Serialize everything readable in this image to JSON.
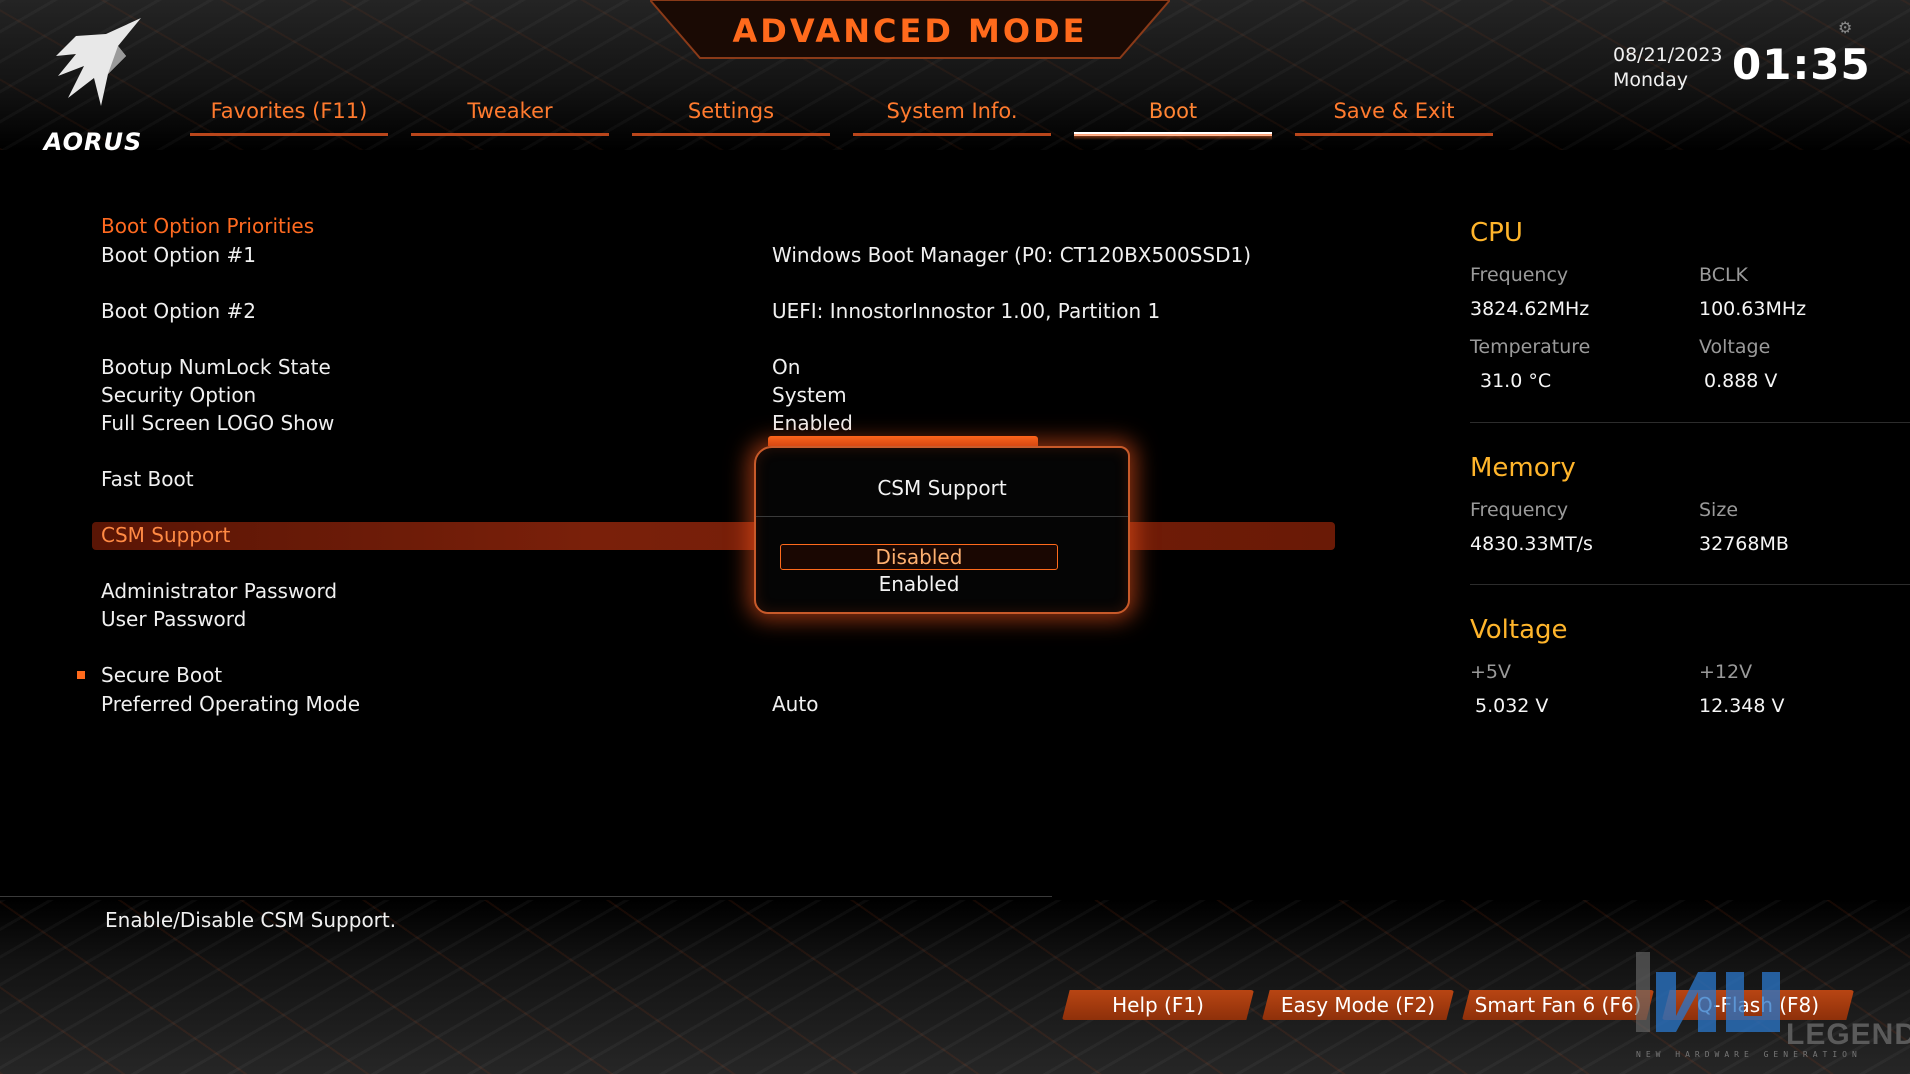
{
  "header": {
    "title": "ADVANCED MODE",
    "brand": "AORUS",
    "date": "08/21/2023",
    "day": "Monday",
    "time": "01:35"
  },
  "tabs": [
    {
      "label": "Favorites (F11)",
      "active": false
    },
    {
      "label": "Tweaker",
      "active": false
    },
    {
      "label": "Settings",
      "active": false
    },
    {
      "label": "System Info.",
      "active": false
    },
    {
      "label": "Boot",
      "active": true
    },
    {
      "label": "Save & Exit",
      "active": false
    }
  ],
  "menu": {
    "section_header": "Boot Option Priorities",
    "items": [
      {
        "label": "Boot Option #1",
        "value": "Windows Boot Manager (P0: CT120BX500SSD1)"
      },
      {
        "label": "Boot Option #2",
        "value": "UEFI: InnostorInnostor 1.00, Partition 1"
      },
      {
        "label": "Bootup NumLock State",
        "value": "On"
      },
      {
        "label": "Security Option",
        "value": "System"
      },
      {
        "label": "Full Screen LOGO Show",
        "value": "Enabled"
      },
      {
        "label": "Fast Boot",
        "value": ""
      },
      {
        "label": "CSM Support",
        "value": "",
        "selected": true
      },
      {
        "label": "Administrator Password",
        "value": ""
      },
      {
        "label": "User Password",
        "value": ""
      },
      {
        "label": "Secure Boot",
        "value": ""
      },
      {
        "label": "Preferred Operating Mode",
        "value": "Auto"
      }
    ]
  },
  "popup": {
    "title": "CSM Support",
    "options": [
      "Disabled",
      "Enabled"
    ],
    "selected": "Disabled"
  },
  "panel": {
    "cpu": {
      "title": "CPU",
      "freq_label": "Frequency",
      "freq": "3824.62MHz",
      "bclk_label": "BCLK",
      "bclk": "100.63MHz",
      "temp_label": "Temperature",
      "temp": "31.0 °C",
      "volt_label": "Voltage",
      "volt": "0.888 V"
    },
    "memory": {
      "title": "Memory",
      "freq_label": "Frequency",
      "freq": "4830.33MT/s",
      "size_label": "Size",
      "size": "32768MB"
    },
    "voltage": {
      "title": "Voltage",
      "v5_label": "+5V",
      "v5": "5.032 V",
      "v12_label": "+12V",
      "v12": "12.348 V"
    }
  },
  "help_text": "Enable/Disable CSM Support.",
  "buttons": [
    "Help (F1)",
    "Easy Mode (F2)",
    "Smart Fan 6 (F6)",
    "Q-Flash (F8)"
  ],
  "watermark": {
    "text": "LEGEND",
    "subtitle": "NEW HARDWARE GENERATION"
  },
  "colors": {
    "accent": "#ff6a1c",
    "highlight": "#7a200a",
    "panel_title": "#ffb52b"
  }
}
